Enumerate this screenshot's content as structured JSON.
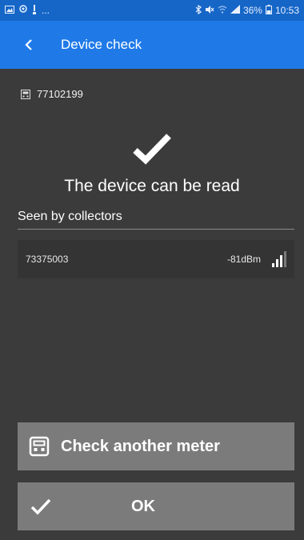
{
  "status_bar": {
    "left_icons": [
      "image-icon",
      "location-icon",
      "notification-icon",
      "more-icon"
    ],
    "more_text": "...",
    "right_text": "36%",
    "time": "10:53",
    "icons": [
      "bluetooth-icon",
      "mute-icon",
      "wifi-icon",
      "signal-icon",
      "battery-icon"
    ]
  },
  "app_bar": {
    "back_icon": "back-chevron-icon",
    "title": "Device check"
  },
  "meter": {
    "icon": "meter-icon",
    "id": "77102199"
  },
  "result": {
    "icon": "checkmark-icon",
    "text": "The device can be read"
  },
  "collectors": {
    "title": "Seen by collectors",
    "items": [
      {
        "id": "73375003",
        "signal": "-81dBm",
        "signal_bars_level": 3,
        "signal_bars_total": 4
      }
    ]
  },
  "buttons": {
    "check_another": {
      "icon": "meter-icon",
      "label": "Check another meter"
    },
    "ok": {
      "icon": "checkmark-icon",
      "label": "OK"
    }
  },
  "colors": {
    "status_bar": "#1566c7",
    "app_bar": "#1f7ae8",
    "background": "#3b3b3b",
    "button": "#7b7b7b"
  }
}
